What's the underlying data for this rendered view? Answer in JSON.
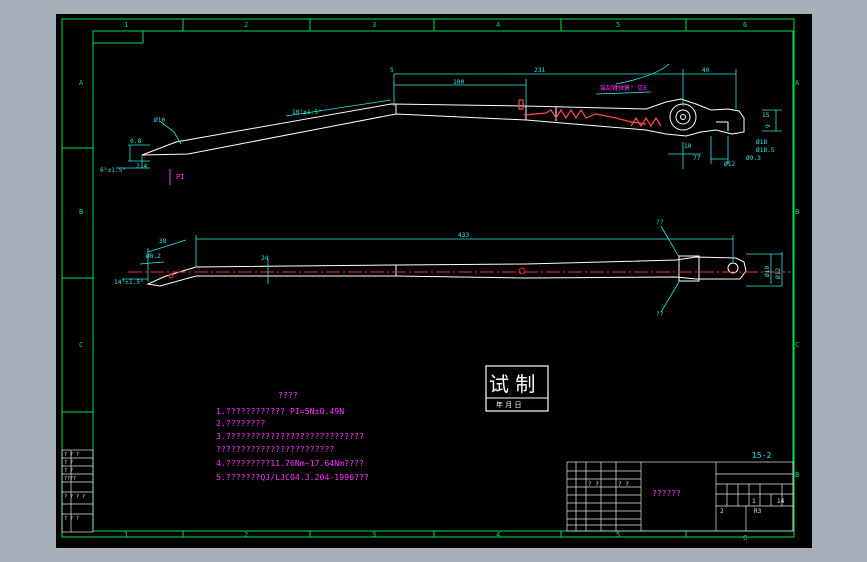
{
  "colors": {
    "frame": "#00e050",
    "drawing": "#ffffff",
    "dimension": "#2ee6e6",
    "centerline": "#ff2a2a",
    "notes": "#ff33ff",
    "spring": "#ff4b4b",
    "titleblock": "#e6e6e6"
  },
  "frame": {
    "col_labels": [
      "1",
      "2",
      "3",
      "4",
      "5",
      "6"
    ],
    "row_labels": [
      "A",
      "B",
      "C",
      "D"
    ],
    "corner_label": "B"
  },
  "top_view": {
    "dims": {
      "d5": "5",
      "d100": "100",
      "d231": "231",
      "d40": "40",
      "d15": "15",
      "d9": "9",
      "d10": "10",
      "d77": "77",
      "phi12": "Ø12",
      "phi18": "Ø18",
      "phi18b": "Ø18.5",
      "phi9": "Ø9.3",
      "phi10": "Ø10",
      "d08": "0.8",
      "d24": "2.4",
      "angle1": "10°±1.5°",
      "angle2": "6°±1.5°",
      "spring_label": "装刮臂弹簧\" 见E",
      "plane_marker": "PI"
    }
  },
  "side_view": {
    "dims": {
      "d433": "433",
      "d38": "38",
      "d24": "24",
      "phi8": "Ø8.2",
      "phi10": "Ø10",
      "phi12": "Ø12",
      "angle": "14°±1.5°",
      "mark_top": "??",
      "mark_bot": "??"
    }
  },
  "stamp": {
    "big": "试 制",
    "small": "年 月 日"
  },
  "notes": {
    "title": "????",
    "lines": [
      "1.???????????? PI=5N±0.49N",
      "2.????????",
      "3.????????????????????????????",
      "????????????????????????",
      "4.?????????11.76Nm~17.64Nm????",
      "5.???????QJ/LJC04.3.204-1996???"
    ]
  },
  "title_block": {
    "doc_code": "15-2",
    "name": "??????",
    "sheet_no": "1",
    "total": "14",
    "scale": "R3",
    "mid_cells": [
      "? ?",
      "? ?"
    ],
    "rev": "2"
  },
  "left_block": {
    "rows": [
      "? ?  ?",
      "? ?",
      "? ?",
      "????",
      "? ? ? ?",
      "? ? ?"
    ]
  }
}
